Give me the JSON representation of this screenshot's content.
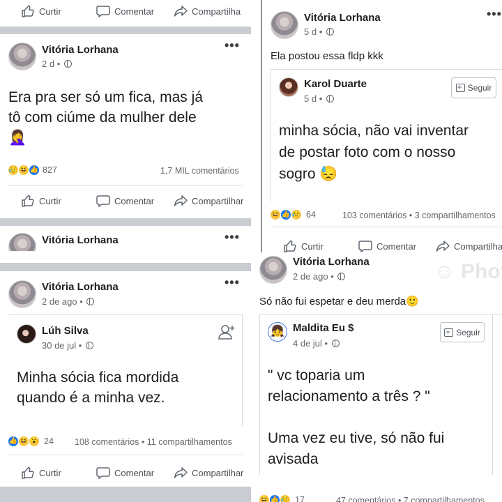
{
  "actions": {
    "like": "Curtir",
    "comment": "Comentar",
    "share": "Compartilhar"
  },
  "follow_label": "Seguir",
  "top_strip": {
    "like": "Curtir",
    "comment": "Comentar",
    "share": "Compartilha"
  },
  "post1": {
    "author": "Vitória Lorhana",
    "time": "2 d",
    "text_line1": "Era pra ser só um fica, mas já",
    "text_line2": "tô com ciúme da mulher dele",
    "emoji": "🤦‍♀️",
    "reactions_count": "827",
    "comments": "1,7 MIL comentários",
    "share_label": "Compartilhar"
  },
  "post2_partial": {
    "author": "Vitória Lorhana"
  },
  "post3": {
    "author": "Vitória Lorhana",
    "time": "2 de ago",
    "shared_author": "Lúh Silva",
    "shared_time": "30 de jul",
    "text_line1": "Minha sócia fica mordida",
    "text_line2": "quando é a minha vez.",
    "reactions_count": "24",
    "comments": "108 comentários",
    "shares": "11 compartilhamentos"
  },
  "post4": {
    "author": "Vitória Lorhana",
    "time": "5 d",
    "caption": "Ela postou essa fldp kkk",
    "shared_author": "Karol Duarte",
    "shared_time": "5 d",
    "text_line1": "minha sócia, não vai inventar",
    "text_line2": "de postar foto com o nosso",
    "text_line3": "sogro",
    "emoji": "😓",
    "reactions_count": "64",
    "comments": "103 comentários",
    "shares": "3 compartilhamentos",
    "share_label": "Compartilha"
  },
  "post5": {
    "author": "Vitória Lorhana",
    "time": "2 de ago",
    "caption": "Só não fui espetar e deu merda",
    "caption_emoji": "🙂",
    "shared_author": "Maldita Eu $",
    "shared_time": "4 de jul",
    "text_line1": "\" vc toparia um",
    "text_line2": "relacionamento a três ? \"",
    "text_line3": "Uma vez eu tive, só não fui",
    "text_line4": "avisada",
    "reactions_count": "17",
    "comments": "47 comentários",
    "shares": "7 compartilhamentos"
  },
  "watermark": "Phot",
  "icons": [
    "like-icon",
    "comment-icon",
    "share-icon",
    "globe-icon",
    "more-icon",
    "follow-icon",
    "add-friend-icon"
  ]
}
